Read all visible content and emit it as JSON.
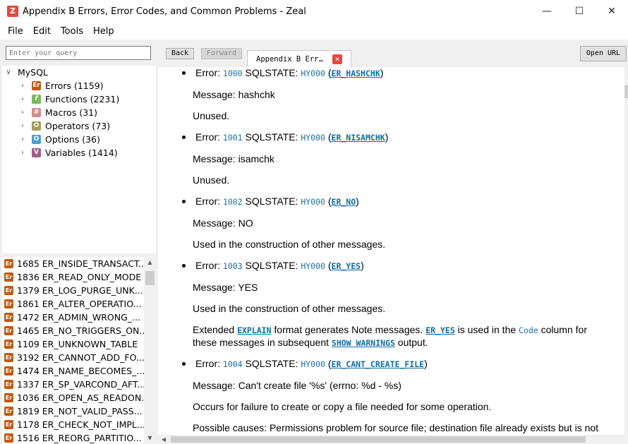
{
  "window": {
    "title": "Appendix B Errors, Error Codes, and Common Problems - Zeal",
    "app_icon": "Z",
    "minimize": "—",
    "maximize": "☐",
    "close": "✕"
  },
  "menu": [
    "File",
    "Edit",
    "Tools",
    "Help"
  ],
  "search": {
    "placeholder": "Enter your query"
  },
  "tree": {
    "root": "MySQL",
    "items": [
      {
        "label": "Errors (1159)",
        "icon": "Er",
        "color": "#c05a0c"
      },
      {
        "label": "Functions (2231)",
        "icon": "f",
        "color": "#7cb95c"
      },
      {
        "label": "Macros (31)",
        "icon": "#",
        "color": "#d98a8a"
      },
      {
        "label": "Operators (73)",
        "icon": "O",
        "color": "#a89a5a"
      },
      {
        "label": "Options (36)",
        "icon": "O",
        "color": "#4aa0c9"
      },
      {
        "label": "Variables (1414)",
        "icon": "V",
        "color": "#a05a8a"
      }
    ]
  },
  "results": [
    "1685 ER_INSIDE_TRANSACT...",
    "1836 ER_READ_ONLY_MODE",
    "1379 ER_LOG_PURGE_UNK...",
    "1861 ER_ALTER_OPERATIO...",
    "1472 ER_ADMIN_WRONG_...",
    "1465 ER_NO_TRIGGERS_ON...",
    "1109 ER_UNKNOWN_TABLE",
    "3192 ER_CANNOT_ADD_FO...",
    "1474 ER_NAME_BECOMES_...",
    "1337 ER_SP_VARCOND_AFT...",
    "1036 ER_OPEN_AS_READON...",
    "1819 ER_NOT_VALID_PASS...",
    "1178 ER_CHECK_NOT_IMPL...",
    "1516 ER_REORG_PARTITIO..."
  ],
  "toolbar": {
    "back": "Back",
    "forward": "Forward",
    "tab_title": "Appendix  B Err…",
    "tab_close": "✕",
    "open_url": "Open URL"
  },
  "content": {
    "error_label": "Error:",
    "sqlstate_label": "SQLSTATE:",
    "entries": [
      {
        "code": "1000",
        "state": "HY000",
        "name": "ER_HASHCHK",
        "message": "Message: hashchk",
        "note": "Unused."
      },
      {
        "code": "1001",
        "state": "HY000",
        "name": "ER_NISAMCHK",
        "message": "Message: isamchk",
        "note": "Unused."
      },
      {
        "code": "1002",
        "state": "HY000",
        "name": "ER_NO",
        "message": "Message: NO",
        "note": "Used in the construction of other messages."
      },
      {
        "code": "1003",
        "state": "HY000",
        "name": "ER_YES",
        "message": "Message: YES",
        "note": "Used in the construction of other messages."
      },
      {
        "code": "1004",
        "state": "HY000",
        "name": "ER_CANT_CREATE_FILE",
        "message": "Message: Can't create file '%s' (errno: %d - %s)",
        "note": "Occurs for failure to create or copy a file needed for some operation."
      }
    ],
    "extended": {
      "t1": "Extended ",
      "explain": "EXPLAIN",
      "t2": " format generates Note messages. ",
      "er_yes": "ER_YES",
      "t3": " is used in the ",
      "code": "Code",
      "t4": " column for these messages in subsequent ",
      "show_warnings": "SHOW WARNINGS",
      "t5": " output."
    },
    "possible_causes": "Possible causes: Permissions problem for source file; destination file already exists but is not"
  }
}
